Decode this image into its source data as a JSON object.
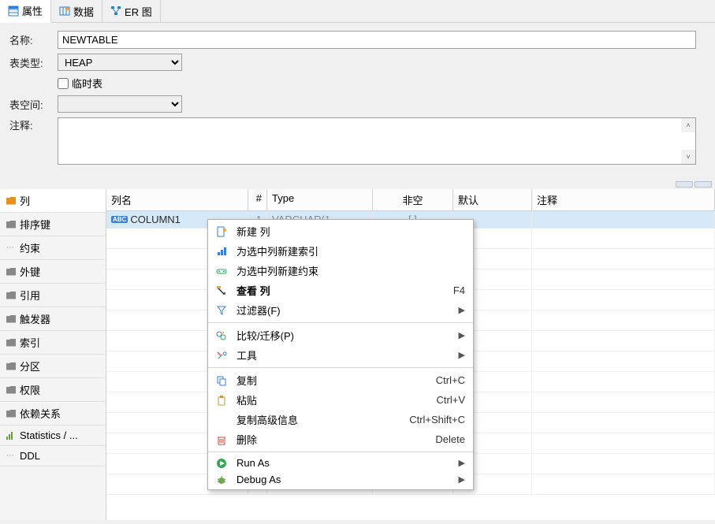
{
  "tabs": {
    "props": "属性",
    "data": "数据",
    "er": "ER 图"
  },
  "form": {
    "nameLabel": "名称:",
    "nameValue": "NEWTABLE",
    "typeLabel": "表类型:",
    "typeValue": "HEAP",
    "tempLabel": "临时表",
    "tablespaceLabel": "表空间:",
    "tablespaceValue": "",
    "commentLabel": "注释:",
    "commentValue": ""
  },
  "sidebar": {
    "items": [
      {
        "label": "列",
        "active": true
      },
      {
        "label": "排序键"
      },
      {
        "label": "约束"
      },
      {
        "label": "外键"
      },
      {
        "label": "引用"
      },
      {
        "label": "触发器"
      },
      {
        "label": "索引"
      },
      {
        "label": "分区"
      },
      {
        "label": "权限"
      },
      {
        "label": "依赖关系"
      },
      {
        "label": "Statistics / ..."
      },
      {
        "label": "DDL"
      }
    ]
  },
  "table": {
    "headers": {
      "colname": "列名",
      "num": "#",
      "type": "Type",
      "notnull": "非空",
      "def": "默认",
      "comment": "注释"
    },
    "rows": [
      {
        "name": "COLUMN1",
        "num": "1",
        "type": "VARCHAR(1...",
        "notnull": "[ ]",
        "def": "",
        "comment": ""
      }
    ]
  },
  "menu": {
    "items": [
      {
        "icon": "new",
        "label": "新建 列"
      },
      {
        "icon": "index",
        "label": "为选中列新建索引"
      },
      {
        "icon": "constraint",
        "label": "为选中列新建约束"
      },
      {
        "icon": "view",
        "label": "查看 列",
        "bold": true,
        "shortcut": "F4"
      },
      {
        "icon": "filter",
        "label": "过滤器(F)",
        "submenu": true
      },
      {
        "sep": true
      },
      {
        "icon": "compare",
        "label": "比较/迁移(P)",
        "submenu": true
      },
      {
        "icon": "tools",
        "label": "工具",
        "submenu": true
      },
      {
        "sep": true
      },
      {
        "icon": "copy",
        "label": "复制",
        "shortcut": "Ctrl+C"
      },
      {
        "icon": "paste",
        "label": "粘贴",
        "shortcut": "Ctrl+V"
      },
      {
        "icon": "",
        "label": "复制高级信息",
        "shortcut": "Ctrl+Shift+C"
      },
      {
        "icon": "delete",
        "label": "删除",
        "shortcut": "Delete"
      },
      {
        "sep": true
      },
      {
        "icon": "run",
        "label": "Run As",
        "submenu": true
      },
      {
        "icon": "debug",
        "label": "Debug As",
        "submenu": true
      }
    ]
  }
}
